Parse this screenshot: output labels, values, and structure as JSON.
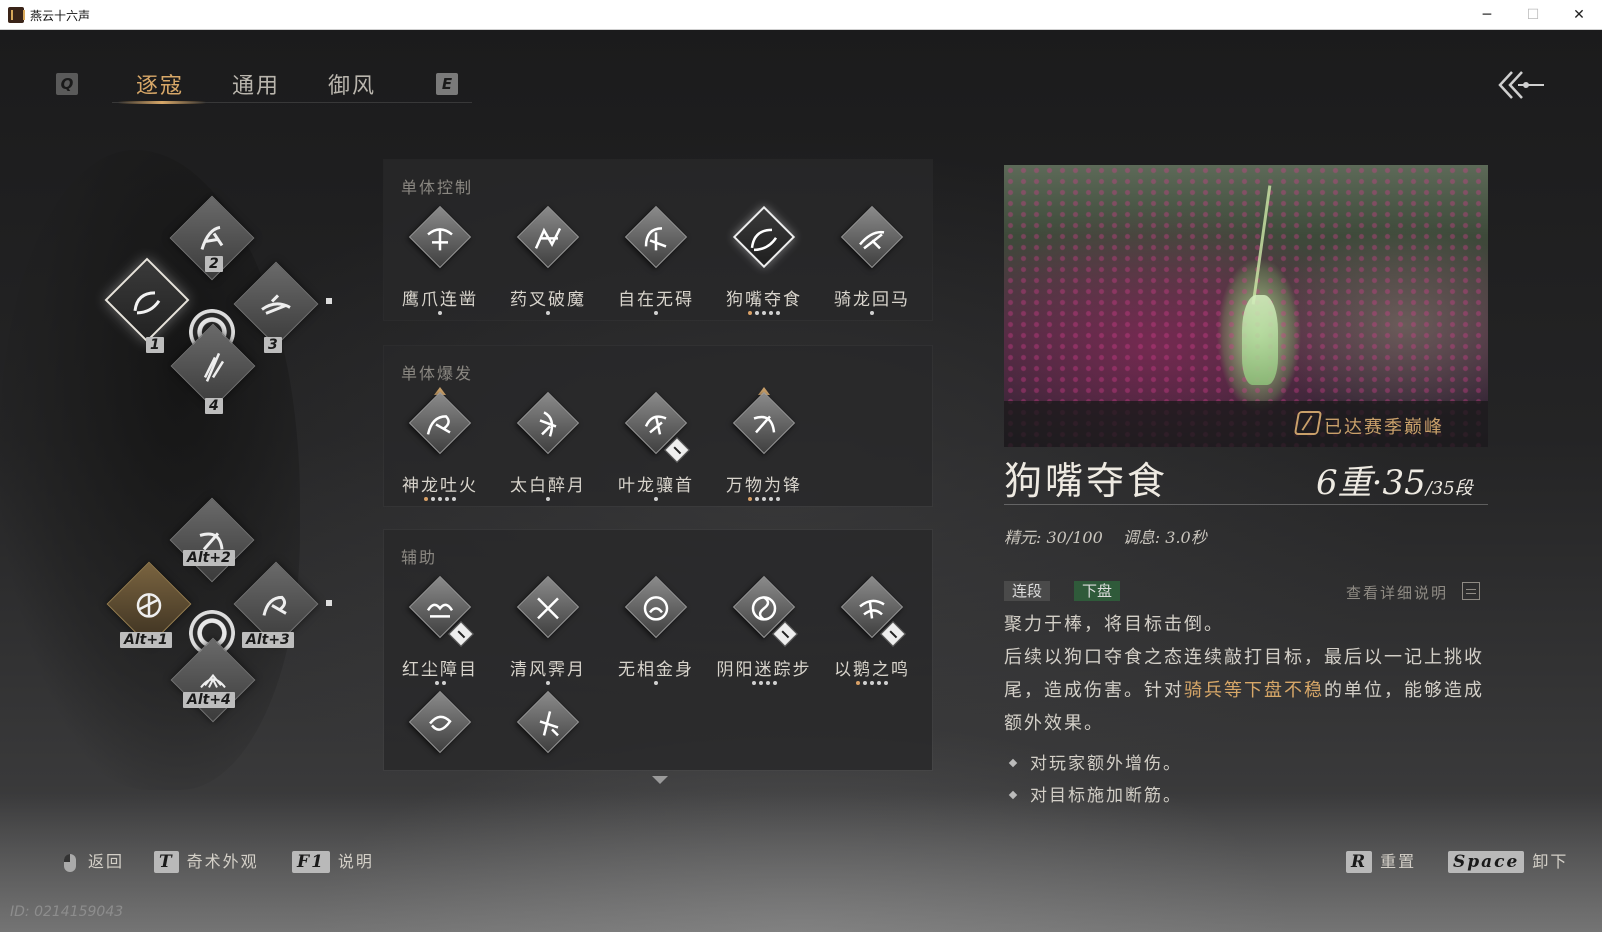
{
  "window": {
    "title": "燕云十六声",
    "minimize": "─",
    "maximize": "☐",
    "close": "✕"
  },
  "tabs": {
    "prev_key": "Q",
    "next_key": "E",
    "items": [
      "逐寇",
      "通用",
      "御风"
    ],
    "active": "逐寇"
  },
  "wheel_top": {
    "slots": [
      {
        "key": "1",
        "icon": "claw-swirl-icon"
      },
      {
        "key": "2",
        "icon": "leap-kick-icon"
      },
      {
        "key": "3",
        "icon": "horse-rider-icon"
      },
      {
        "key": "4",
        "icon": "blade-slash-icon"
      }
    ]
  },
  "wheel_bottom": {
    "slots": [
      {
        "key": "Alt+1",
        "icon": "archer-icon"
      },
      {
        "key": "Alt+2",
        "icon": "sword-arc-icon"
      },
      {
        "key": "Alt+3",
        "icon": "dragon-fire-icon"
      },
      {
        "key": "Alt+4",
        "icon": "golden-fan-icon"
      }
    ]
  },
  "panels": [
    {
      "title": "单体控制",
      "skills": [
        {
          "name": "鹰爪连凿",
          "dots": 1,
          "gold_dots": 0
        },
        {
          "name": "药叉破魔",
          "dots": 1,
          "gold_dots": 0
        },
        {
          "name": "自在无碍",
          "dots": 1,
          "gold_dots": 0
        },
        {
          "name": "狗嘴夺食",
          "dots": 5,
          "gold_dots": 1
        },
        {
          "name": "骑龙回马",
          "dots": 1,
          "gold_dots": 0
        }
      ]
    },
    {
      "title": "单体爆发",
      "skills": [
        {
          "name": "神龙吐火",
          "dots": 5,
          "gold_dots": 1
        },
        {
          "name": "太白醉月",
          "dots": 1,
          "gold_dots": 0
        },
        {
          "name": "叶龙骧首",
          "dots": 1,
          "gold_dots": 0
        },
        {
          "name": "万物为锋",
          "dots": 5,
          "gold_dots": 1
        }
      ]
    },
    {
      "title": "辅助",
      "skills": [
        {
          "name": "红尘障目",
          "dots": 2,
          "gold_dots": 0
        },
        {
          "name": "清风霁月",
          "dots": 1,
          "gold_dots": 0
        },
        {
          "name": "无相金身",
          "dots": 1,
          "gold_dots": 0
        },
        {
          "name": "阴阳迷踪步",
          "dots": 4,
          "gold_dots": 0
        },
        {
          "name": "以鹅之鸣",
          "dots": 5,
          "gold_dots": 1
        },
        {
          "name": "",
          "dots": 0,
          "gold_dots": 0
        },
        {
          "name": "",
          "dots": 0,
          "gold_dots": 0
        }
      ]
    }
  ],
  "detail": {
    "caption": "已达赛季巅峰",
    "name": "狗嘴夺食",
    "level_main": "6重·35",
    "level_sub": "/35段",
    "energy": "精元: 30/100",
    "cooldown": "调息: 3.0秒",
    "tags": [
      "连段",
      "下盘"
    ],
    "more_label": "查看详细说明",
    "desc_line1": "聚力于棒，将目标击倒。",
    "desc_line2_a": "后续以狗口夺食之态连续敲打目标，最后以一记上挑收尾，造成伤害。针对",
    "desc_line2_hl": "骑兵等下盘不稳",
    "desc_line2_b": "的单位，能够造成额外效果。",
    "bullets": [
      "对玩家额外增伤。",
      "对目标施加断筋。"
    ]
  },
  "footer": {
    "back_label": "返回",
    "appearance_key": "T",
    "appearance_label": "奇术外观",
    "help_key": "F1",
    "help_label": "说明",
    "reset_key": "R",
    "reset_label": "重置",
    "unequip_key": "Space",
    "unequip_label": "卸下",
    "player_id": "ID: 0214159043"
  }
}
